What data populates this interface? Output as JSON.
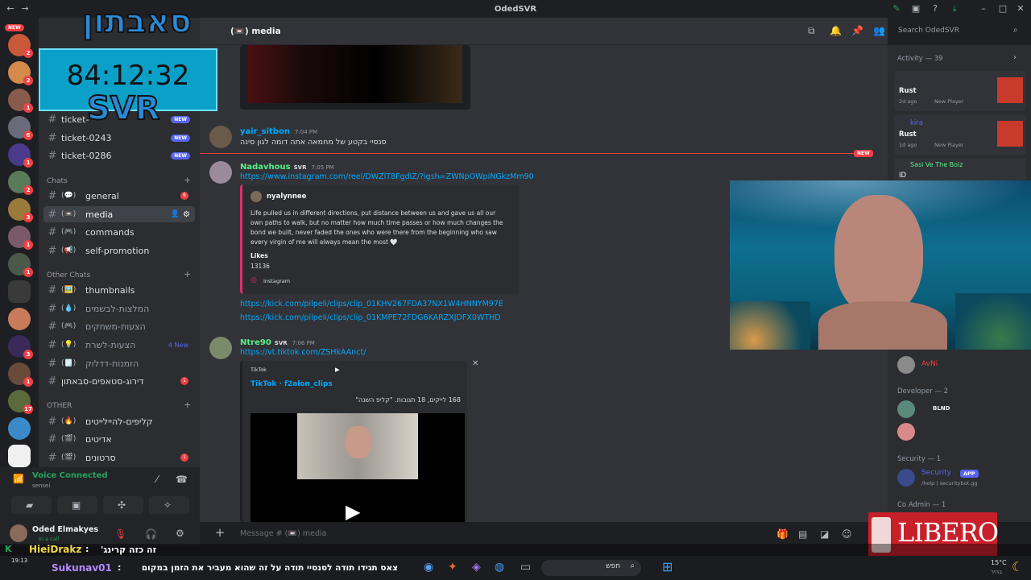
{
  "window": {
    "title": "OdedSVR"
  },
  "stream_overlay": {
    "logo_text": "סאבתון",
    "timer": "84:12:32",
    "logo_sub": "SVR",
    "libero_text": "LIBERO"
  },
  "server_rail": {
    "new_label": "NEW",
    "badges": [
      "2",
      "2",
      "1",
      "6",
      "1",
      "2",
      "3",
      "1",
      "1",
      "3",
      "1",
      "17"
    ]
  },
  "channels": {
    "tickets": [
      {
        "name": "ticket-",
        "badge": "NEW"
      },
      {
        "name": "ticket-0243",
        "badge": "NEW"
      },
      {
        "name": "ticket-0286",
        "badge": "NEW"
      }
    ],
    "cat_chats": "Chats",
    "chats": [
      {
        "emoji": "(💬)",
        "name": "general",
        "count": "6"
      },
      {
        "emoji": "(📼)",
        "name": "media",
        "active": true
      },
      {
        "emoji": "(🎮)",
        "name": "commands"
      },
      {
        "emoji": "(📢)",
        "name": "self-promotion"
      }
    ],
    "cat_other_chats": "Other Chats",
    "other_chats": [
      {
        "emoji": "(🖼️)",
        "name": "thumbnails"
      },
      {
        "emoji": "(💧)",
        "name": "המלצות-לבשמים"
      },
      {
        "emoji": "(🎮)",
        "name": "הצעות-משחקים"
      },
      {
        "emoji": "(💡)",
        "name": "הצעות-לשרת",
        "new": "4 New"
      },
      {
        "emoji": "(🗒️)",
        "name": "הזמנות-דדלוק"
      },
      {
        "emoji": "",
        "name": "דירוג-סטאפים-סבאתון",
        "count": "1"
      }
    ],
    "cat_other": "OTHER",
    "other": [
      {
        "emoji": "(🔥)",
        "name": "קליפים-להיילייטים"
      },
      {
        "emoji": "(🎬)",
        "name": "אדיטים"
      },
      {
        "emoji": "(🎬)",
        "name": "סרטונים",
        "count": "1"
      }
    ]
  },
  "voice": {
    "status": "Voice Connected",
    "channel": "sensei"
  },
  "user": {
    "name": "Oded Elmakyes",
    "status": "In a call"
  },
  "chat_header": {
    "channel": "(📼) media",
    "search_placeholder": "Search OdedSVR"
  },
  "messages": [
    {
      "user": "yair_sitbon",
      "time": "7:04 PM",
      "text": "סנסיי בקטע של מחמאה אתה דומה לגון סינה"
    },
    {
      "user": "Nadavhous",
      "tag": "SVR",
      "time": "7:05 PM",
      "link": "https://www.instagram.com/reel/DWZlT8FgdiZ/?igsh=ZWNpOWpiNGkzMm90",
      "embed": {
        "author": "nyalynnee",
        "body": "Life pulled us in different directions, put distance between us and gave us all our own paths to walk, but no matter how much time passes or how much changes the bond we built, never faded the ones who were there from the beginning who saw every virgin of me will always mean the most 🤍",
        "likes_label": "Likes",
        "likes": "13136",
        "provider": "Instagram"
      },
      "extra_links": [
        "https://kick.com/pilpeli/clips/clip_01KHV267FDA37NX1W4HNNYM97E",
        "https://kick.com/pilpeli/clips/clip_01KMPE72FDG6KARZXJDFX0WTHD"
      ]
    },
    {
      "user": "Ntre90",
      "tag": "SVR",
      "time": "7:06 PM",
      "link": "https://vt.tiktok.com/ZSHkAAnct/",
      "embed": {
        "provider": "TikTok",
        "title": "TikTok · f2alon_clips",
        "desc": "168 לייקים, 18 תגובות. \"קליפ השנה\""
      }
    }
  ],
  "new_divider": "NEW",
  "composer": {
    "placeholder": "Message # (📼) media"
  },
  "members": {
    "activity_header": "Activity — 39",
    "activities": [
      {
        "name": "Rust",
        "sub": "2d ago",
        "badge": "New Player"
      },
      {
        "name": "kira",
        "game": "Rust",
        "sub": "1d ago",
        "badge": "New Player"
      },
      {
        "name": "Sasi Ve The Boiz",
        "game": "ID"
      }
    ],
    "member_avni": "AvNi",
    "dev_header": "Developer — 2",
    "dev_tag": "BLND",
    "security_header": "Security — 1",
    "security_name": "Security",
    "security_app": "APP",
    "security_sub": "/help | securitybot.gg",
    "coadmin_header": "Co Admin — 1"
  },
  "stream_chat": [
    {
      "user": "HieiDrakz",
      "text": "זה כזה קרינג'"
    },
    {
      "user": "Sukunav01",
      "text": "צאס תגידו תודה לסנסיי תודה על זה שהוא מעביר את הזמן במקום"
    }
  ],
  "taskbar": {
    "search": "חפש",
    "time": "19:13",
    "weather": "15°C",
    "weather_sub": "בהיר"
  },
  "colors": {
    "accent": "#5865f2",
    "link": "#00a8fc",
    "danger": "#f23f43",
    "green": "#23a55a"
  }
}
